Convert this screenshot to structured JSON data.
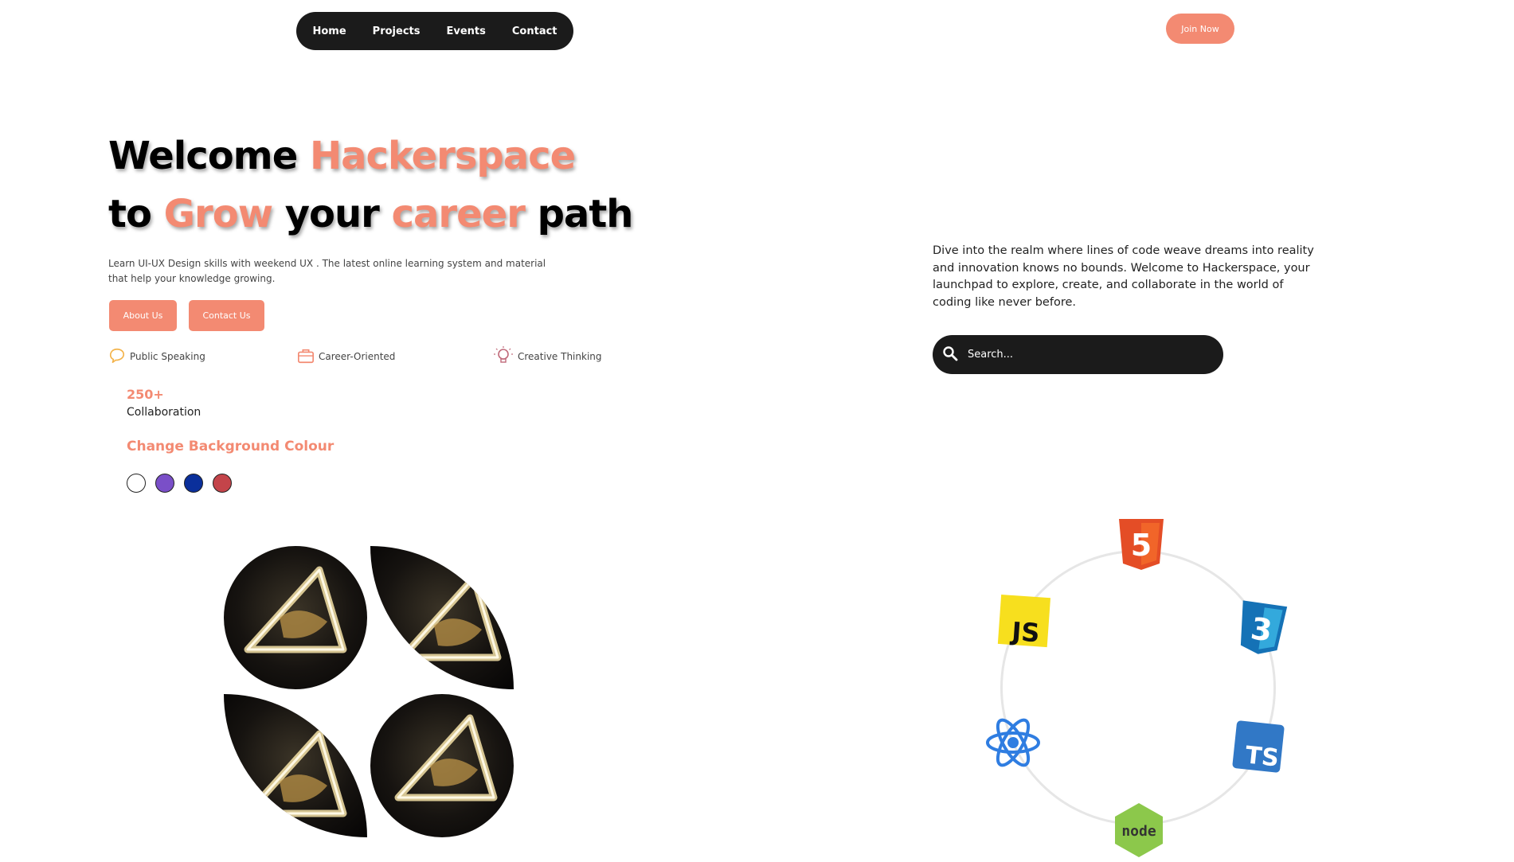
{
  "nav": {
    "items": [
      "Home",
      "Projects",
      "Events",
      "Contact"
    ],
    "join_label": "Join Now"
  },
  "hero": {
    "line1_a": "Welcome ",
    "line1_b": "Hackerspace",
    "line2_a": "to ",
    "line2_b": "Grow",
    "line2_c": " your ",
    "line2_d": "career",
    "line2_e": " path",
    "subtitle": "Learn UI-UX Design skills with weekend UX . The latest online learning system and material that help your knowledge growing.",
    "about_label": "About Us",
    "contact_label": "Contact Us"
  },
  "features": [
    {
      "label": "Public Speaking",
      "icon": "speech-icon"
    },
    {
      "label": "Career-Oriented",
      "icon": "briefcase-icon"
    },
    {
      "label": "Creative Thinking",
      "icon": "lightbulb-icon"
    }
  ],
  "stat": {
    "value": "250+",
    "label": "Collaboration"
  },
  "background": {
    "title": "Change Background Colour",
    "colors": [
      "#ffffff",
      "#7a4fc8",
      "#0a2f9b",
      "#c4444a"
    ]
  },
  "description": "Dive into the realm where lines of code weave dreams into reality and innovation knows no bounds. Welcome to Hackerspace, your launchpad to explore, create, and collaborate in the world of coding like never before.",
  "search": {
    "placeholder": "Search..."
  },
  "tech_icons": [
    "html5-icon",
    "css3-icon",
    "typescript-icon",
    "nodejs-icon",
    "react-icon",
    "javascript-icon"
  ],
  "tech_labels": {
    "js": "JS",
    "ts": "TS",
    "node": "node",
    "html_num": "5",
    "css_num": "3"
  },
  "colors": {
    "accent": "#f38a72",
    "dark": "#1b1b1b"
  }
}
